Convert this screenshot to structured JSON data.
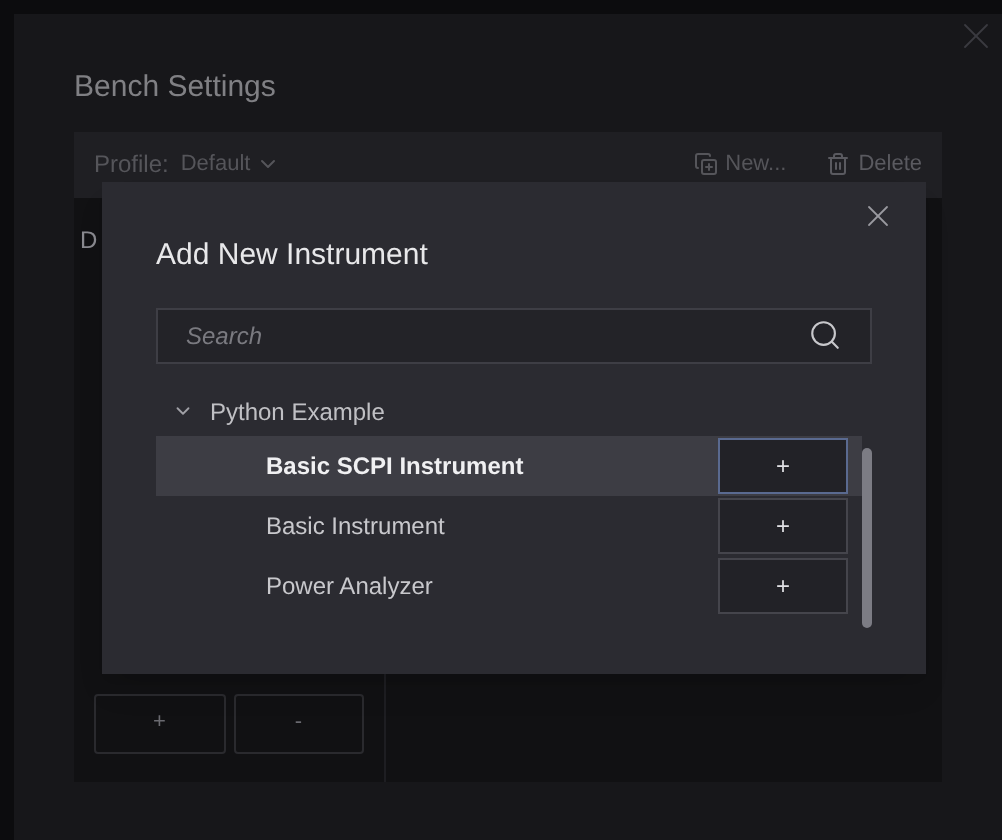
{
  "window": {
    "title": "Bench Settings"
  },
  "toolbar": {
    "profile_label": "Profile:",
    "profile_value": "Default",
    "new_label": "New...",
    "delete_label": "Delete"
  },
  "panel": {
    "column_1": "D"
  },
  "bottom_buttons": [
    "+",
    "-"
  ],
  "modal": {
    "title": "Add New Instrument",
    "search": {
      "placeholder": "Search"
    },
    "tree": [
      {
        "label": "Python Example",
        "expanded": true,
        "children": [
          {
            "label": "Basic SCPI Instrument",
            "selected": true,
            "action": "+"
          },
          {
            "label": "Basic Instrument",
            "selected": false,
            "action": "+"
          },
          {
            "label": "Power Analyzer",
            "selected": false,
            "action": "+"
          }
        ]
      }
    ]
  }
}
